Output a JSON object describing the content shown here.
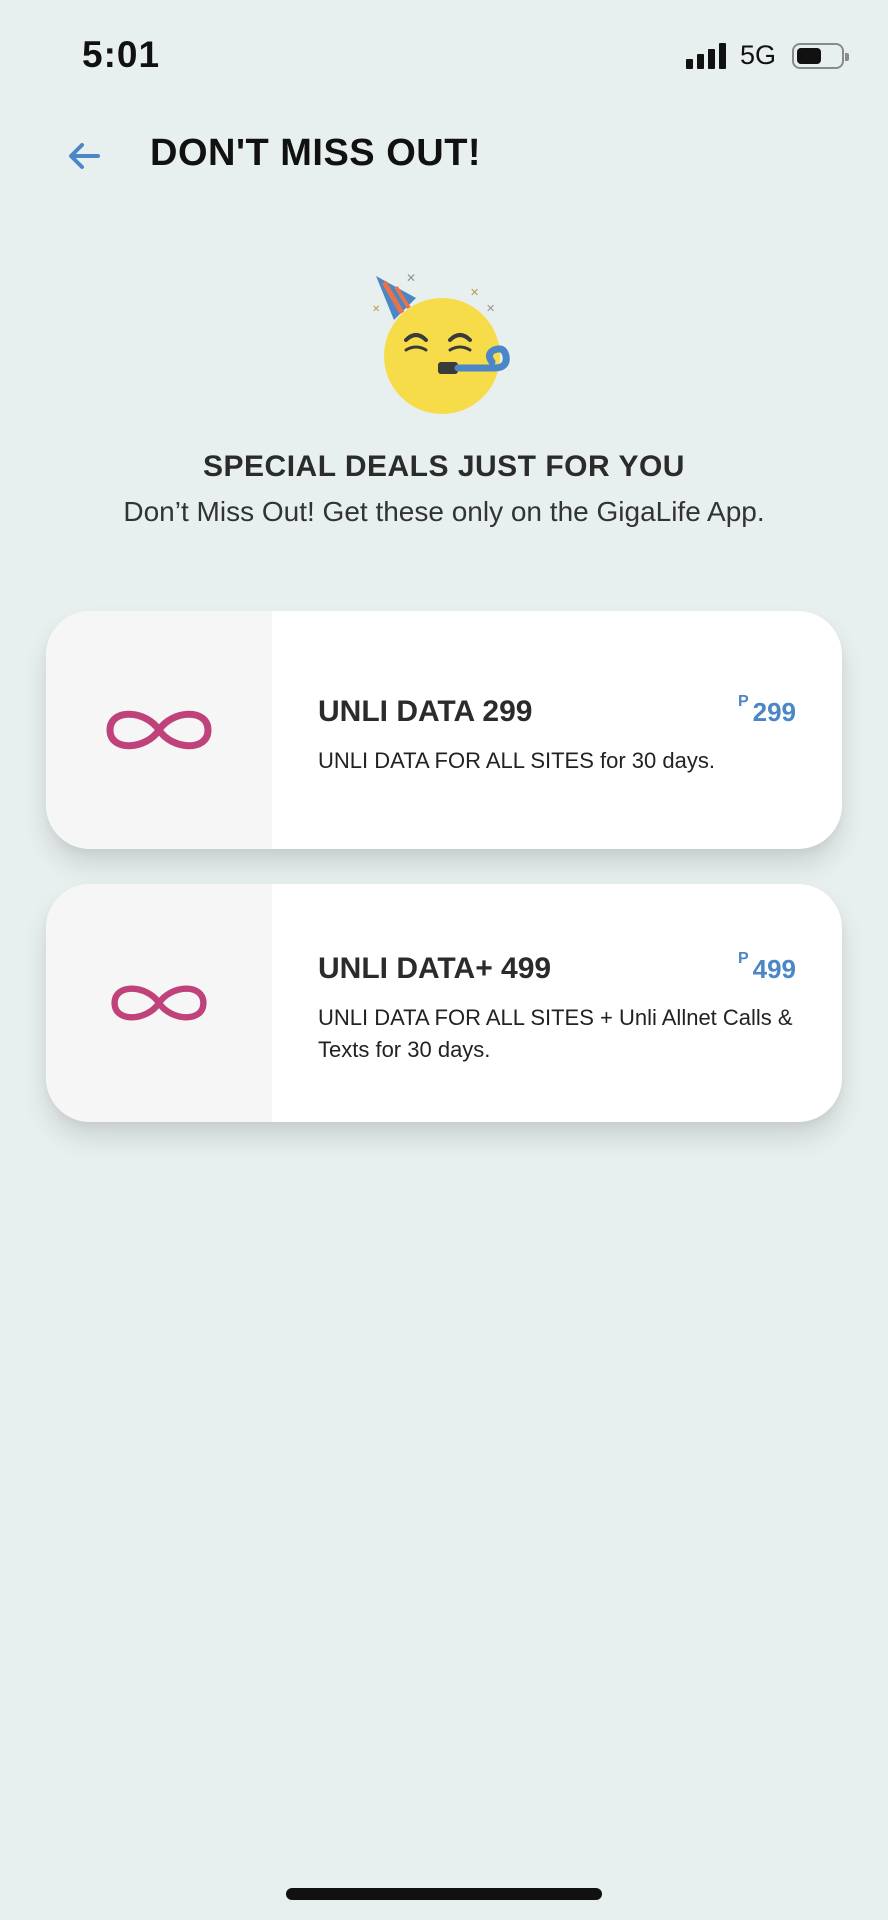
{
  "status_bar": {
    "time": "5:01",
    "network": "5G",
    "battery_level": 0.6
  },
  "header": {
    "title": "DON'T MISS OUT!",
    "back_icon": "arrow-left-icon"
  },
  "hero": {
    "icon": "party-face-icon",
    "heading": "SPECIAL DEALS JUST FOR YOU",
    "subtitle": "Don’t Miss Out! Get these only on the GigaLife App."
  },
  "deals": [
    {
      "icon": "infinity-icon",
      "name": "UNLI DATA 299",
      "currency": "P",
      "price": "299",
      "description": "UNLI DATA FOR ALL SITES for 30 days."
    },
    {
      "icon": "infinity-icon",
      "name": "UNLI DATA+ 499",
      "currency": "P",
      "price": "499",
      "description": "UNLI DATA FOR ALL SITES + Unli Allnet Calls & Texts for 30 days."
    }
  ],
  "colors": {
    "background": "#e8f0ef",
    "accent": "#4b86c6",
    "infinity": "#c0427a",
    "card": "#ffffff",
    "icon_panel": "#f6f6f6"
  }
}
